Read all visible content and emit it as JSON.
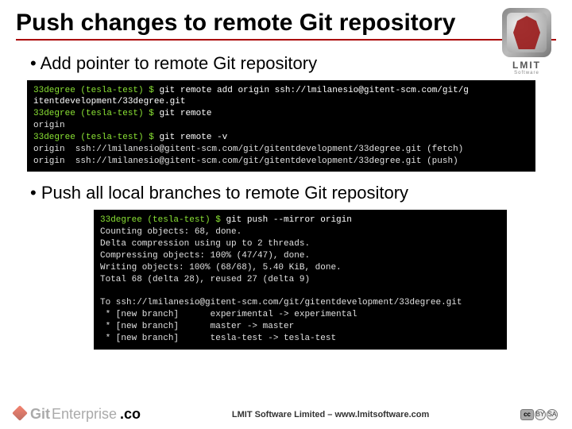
{
  "title": "Push changes to remote Git repository",
  "logo": {
    "name": "LMIT",
    "sub": "Software"
  },
  "bullets": {
    "b1": "Add pointer to remote Git repository",
    "b2": "Push all local branches to remote Git repository"
  },
  "terminal1": {
    "l1p": "33degree (tesla-test) $ ",
    "l1c": "git remote add origin ssh://lmilanesio@gitent-scm.com/git/g",
    "l2": "itentdevelopment/33degree.git",
    "l3p": "33degree (tesla-test) $ ",
    "l3c": "git remote",
    "l4": "origin",
    "l5p": "33degree (tesla-test) $ ",
    "l5c": "git remote -v",
    "l6": "origin  ssh://lmilanesio@gitent-scm.com/git/gitentdevelopment/33degree.git (fetch)",
    "l7": "origin  ssh://lmilanesio@gitent-scm.com/git/gitentdevelopment/33degree.git (push)"
  },
  "terminal2": {
    "l1p": "33degree (tesla-test) $ ",
    "l1c": "git push --mirror origin",
    "l2": "Counting objects: 68, done.",
    "l3": "Delta compression using up to 2 threads.",
    "l4": "Compressing objects: 100% (47/47), done.",
    "l5": "Writing objects: 100% (68/68), 5.40 KiB, done.",
    "l6": "Total 68 (delta 28), reused 27 (delta 9)",
    "l7": "",
    "l8": "To ssh://lmilanesio@gitent-scm.com/git/gitentdevelopment/33degree.git",
    "l9": " * [new branch]      experimental -> experimental",
    "l10": " * [new branch]      master -> master",
    "l11": " * [new branch]      tesla-test -> tesla-test"
  },
  "footer": {
    "git": "Git",
    "enterprise": "Enterprise",
    "co": ".co",
    "center": "LMIT Software Limited – www.lmitsoftware.com",
    "cc": "cc",
    "by": "BY",
    "sa": "SA"
  }
}
